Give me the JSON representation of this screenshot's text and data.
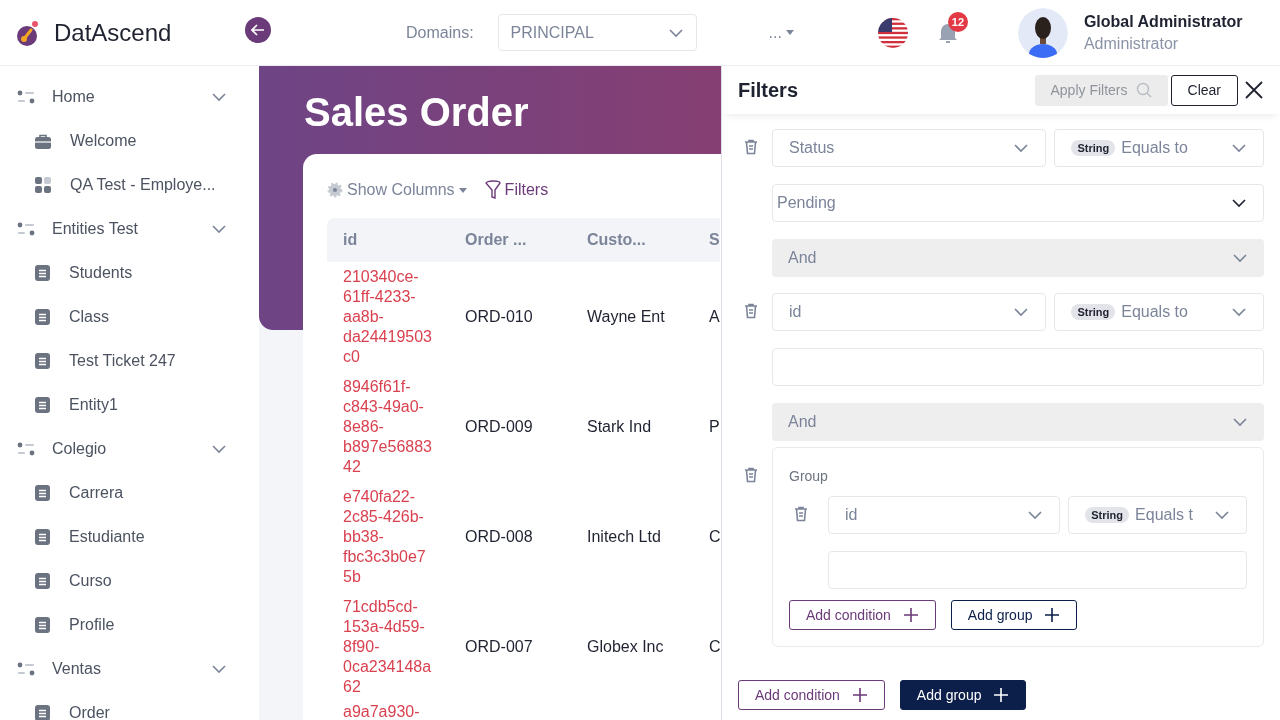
{
  "header": {
    "brand": "DatAscend",
    "domains_label": "Domains:",
    "domain": "PRINCIPAL",
    "more_menu": "...",
    "notifications": "12",
    "user": {
      "name": "Global Administrator",
      "role": "Administrator"
    }
  },
  "sidebar": {
    "groups": [
      {
        "label": "Home",
        "expanded": true,
        "children": [
          {
            "label": "Welcome",
            "kind": "briefcase"
          },
          {
            "label": "QA Test - Employe...",
            "kind": "dashboard"
          }
        ]
      },
      {
        "label": "Entities Test",
        "expanded": true,
        "children": [
          {
            "label": "Students",
            "kind": "entity"
          },
          {
            "label": "Class",
            "kind": "entity"
          },
          {
            "label": "Test Ticket 247",
            "kind": "entity"
          },
          {
            "label": "Entity1",
            "kind": "entity"
          }
        ]
      },
      {
        "label": "Colegio",
        "expanded": true,
        "children": [
          {
            "label": "Carrera",
            "kind": "entity"
          },
          {
            "label": "Estudiante",
            "kind": "entity"
          },
          {
            "label": "Curso",
            "kind": "entity"
          },
          {
            "label": "Profile",
            "kind": "entity"
          }
        ]
      },
      {
        "label": "Ventas",
        "expanded": true,
        "children": [
          {
            "label": "Order",
            "kind": "entity"
          }
        ]
      }
    ]
  },
  "page": {
    "title": "Sales Order",
    "show_columns": "Show Columns",
    "filters_link": "Filters"
  },
  "table": {
    "columns": [
      "id",
      "Order ...",
      "Custo...",
      "S"
    ],
    "rows": [
      {
        "id": "210340ce-61ff-4233-aa8b-da24419503c0",
        "order": "ORD-010",
        "customer": "Wayne Ent",
        "column_4": "A"
      },
      {
        "id": "8946f61f-c843-49a0-8e86-b897e5688342",
        "order": "ORD-009",
        "customer": "Stark Ind",
        "column_4": "P"
      },
      {
        "id": "e740fa22-2c85-426b-bb38-fbc3c3b0e75b",
        "order": "ORD-008",
        "customer": "Initech Ltd",
        "column_4": "C"
      },
      {
        "id": "71cdb5cd-153a-4d59-8f90-0ca234148a62",
        "order": "ORD-007",
        "customer": "Globex Inc",
        "column_4": "C"
      },
      {
        "id": "a9a7a930-"
      }
    ]
  },
  "filters": {
    "title": "Filters",
    "apply_button": {
      "label": "Apply Filters",
      "disabled": true
    },
    "clear_button": "Clear",
    "rules": [
      {
        "kind": "condition",
        "field": "Status",
        "type_badge": "String",
        "operator": "Equals to",
        "value_dropdown": true,
        "value": "Pending"
      },
      {
        "kind": "conjunction",
        "label": "And"
      },
      {
        "kind": "condition",
        "field": "id",
        "type_badge": "String",
        "operator": "Equals to",
        "value_dropdown": false
      },
      {
        "kind": "conjunction",
        "label": "And"
      },
      {
        "kind": "group",
        "title": "Group",
        "rules": [
          {
            "kind": "condition",
            "field": "id",
            "type_badge": "String",
            "operator": "Equals t",
            "value_dropdown": false
          }
        ],
        "add_condition": "Add condition",
        "add_group": "Add group"
      }
    ],
    "add_condition": "Add condition",
    "add_group": "Add group"
  }
}
